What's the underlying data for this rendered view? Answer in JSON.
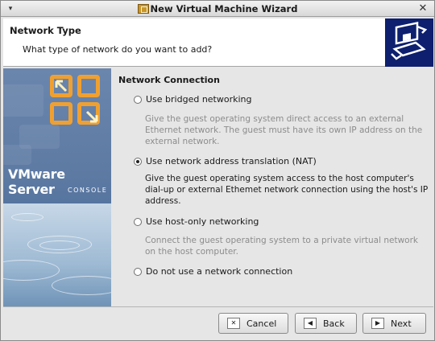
{
  "window": {
    "title": "New Virtual Machine Wizard",
    "menu_glyph": "▾",
    "close_glyph": "✕"
  },
  "header": {
    "title": "Network Type",
    "subtitle": "What type of network do you want to add?"
  },
  "banner": {
    "brand": "VMware Server",
    "product": "CONSOLE"
  },
  "section": {
    "title": "Network Connection",
    "options": [
      {
        "label": "Use bridged networking",
        "selected": false,
        "description": "Give the guest operating system direct access to an external Ethernet network. The guest must have its own IP address on the external network."
      },
      {
        "label": "Use network address translation (NAT)",
        "selected": true,
        "description": "Give the guest operating system access to the host computer's dial-up or external Ethemet network connection using the host's IP address."
      },
      {
        "label": "Use host-only networking",
        "selected": false,
        "description": "Connect the guest operating system to a private virtual network on the host computer."
      },
      {
        "label": "Do not use a network connection",
        "selected": false
      }
    ]
  },
  "buttons": {
    "cancel": "Cancel",
    "back": "Back",
    "next": "Next"
  },
  "colors": {
    "header_icon_bg": "#0d1f6e",
    "logo_orange": "#f0a030"
  },
  "icons": {
    "header": "network-adapter-icon",
    "logo": "vmware-logo-icon",
    "cancel": "close-x-icon",
    "back": "arrow-left-icon",
    "next": "arrow-right-icon"
  }
}
